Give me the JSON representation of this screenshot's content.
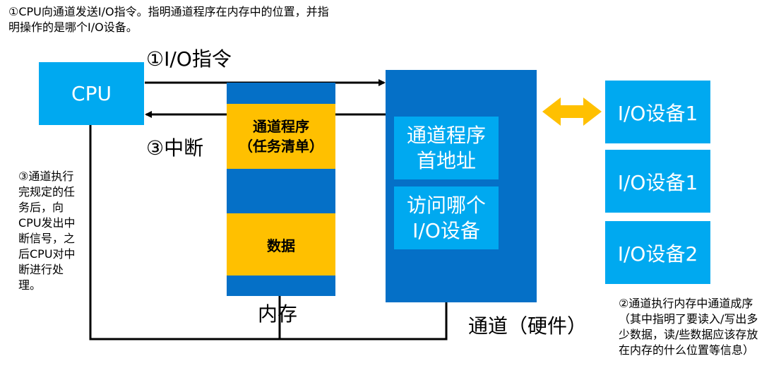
{
  "notes": {
    "top": "①CPU向通道发送I/O指令。指明通道程序在内存中的位置，并指明操作的是哪个I/O设备。",
    "left": "③通道执行完规定的任务后，向CPU发出中断信号，之后CPU对中断进行处理。",
    "right": "②通道执行内存中通道成序（其中指明了要读入/写出多少数据，读/些数据应该存放在内存的什么位置等信息）"
  },
  "cpu": {
    "label": "CPU"
  },
  "arrows": {
    "io_instruction": "①I/O指令",
    "interrupt": "③中断"
  },
  "memory": {
    "label": "内存",
    "program_line1": "通道程序",
    "program_line2": "（任务清单）",
    "data": "数据"
  },
  "channel": {
    "label": "通道（硬件）",
    "addr_line1": "通道程序",
    "addr_line2": "首地址",
    "device_line1": "访问哪个",
    "device_line2": "I/O设备"
  },
  "devices": [
    {
      "label": "I/O设备1"
    },
    {
      "label": "I/O设备1"
    },
    {
      "label": "I/O设备2"
    }
  ],
  "colors": {
    "light_blue": "#00a9f0",
    "dark_blue": "#0570c7",
    "amber": "#ffc000"
  }
}
